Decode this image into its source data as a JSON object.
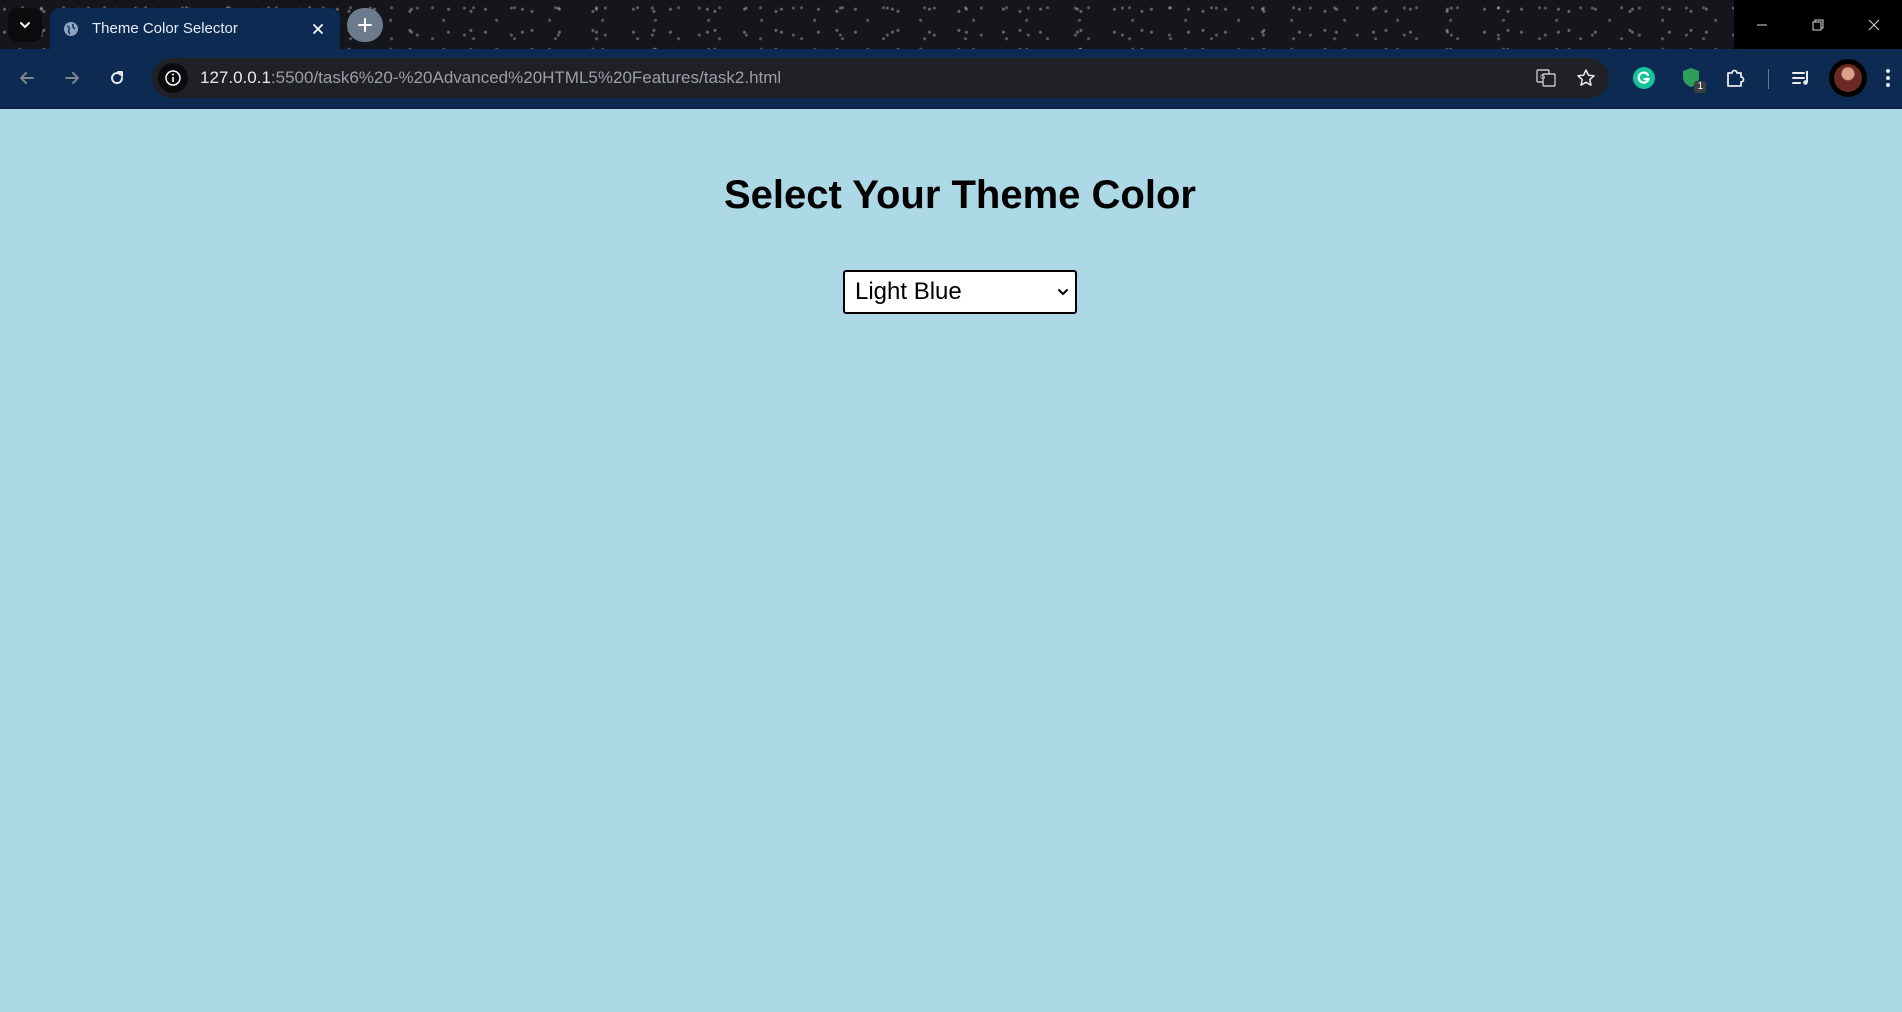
{
  "browser": {
    "tab": {
      "title": "Theme Color Selector"
    },
    "omnibox": {
      "url_host": "127.0.0.1",
      "url_path": ":5500/task6%20-%20Advanced%20HTML5%20Features/task2.html"
    },
    "extensions": {
      "badge_count": "1"
    }
  },
  "page": {
    "title": "Select Your Theme Color",
    "theme_select": {
      "selected": "Light Blue"
    },
    "background_color": "#add8e6"
  },
  "colors": {
    "toolbar": "#0d2a52",
    "page_background": "#add8e6"
  }
}
